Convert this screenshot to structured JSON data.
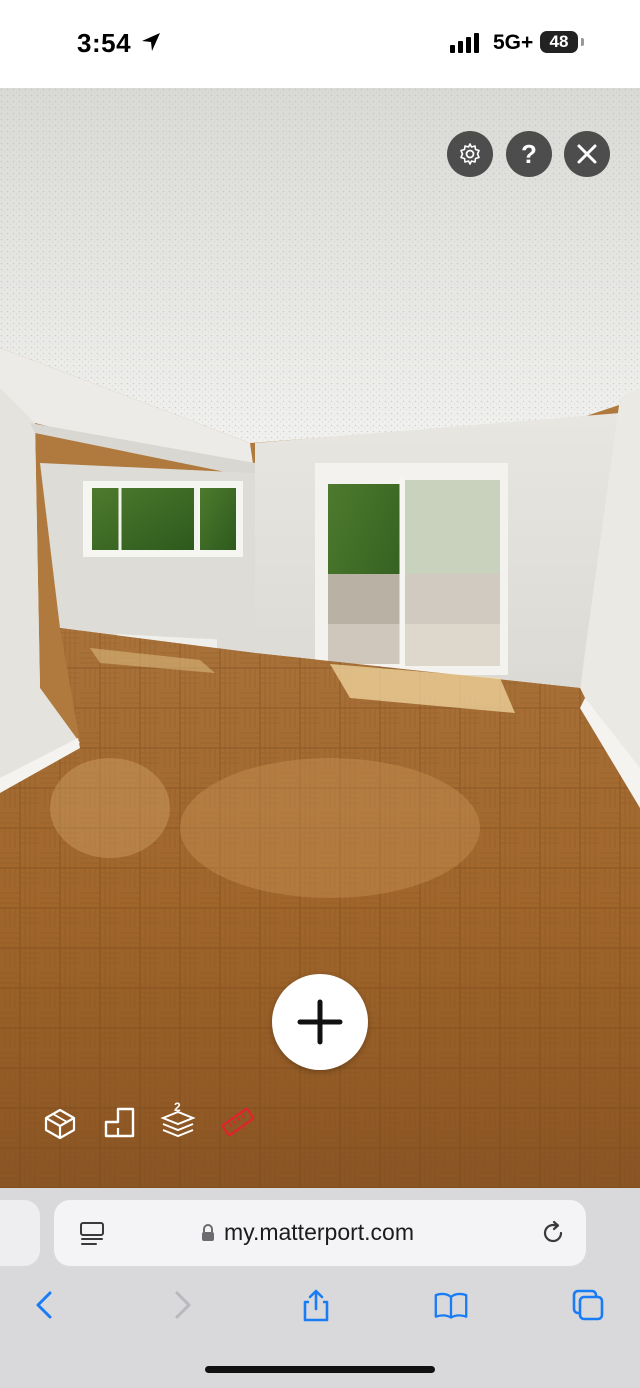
{
  "status_bar": {
    "time": "3:54",
    "network": "5G+",
    "battery": "48",
    "icons": [
      "location-arrow-icon",
      "cell-signal-icon",
      "battery-icon"
    ]
  },
  "viewer": {
    "top_controls": [
      "settings-gear-icon",
      "help-question-icon",
      "close-x-icon"
    ],
    "help_label": "?",
    "add_button_icon": "plus-icon",
    "tools": [
      "dollhouse-icon",
      "floorplan-icon",
      "floors-icon",
      "measure-tape-icon"
    ],
    "floor_count": "2",
    "measure_color": "#e0242b"
  },
  "browser": {
    "url": "my.matterport.com",
    "icons": [
      "reader-icon",
      "lock-icon",
      "reload-icon",
      "back-icon",
      "forward-icon",
      "share-icon",
      "bookmarks-icon",
      "tabs-icon"
    ],
    "accent": "#1a7cf5"
  }
}
